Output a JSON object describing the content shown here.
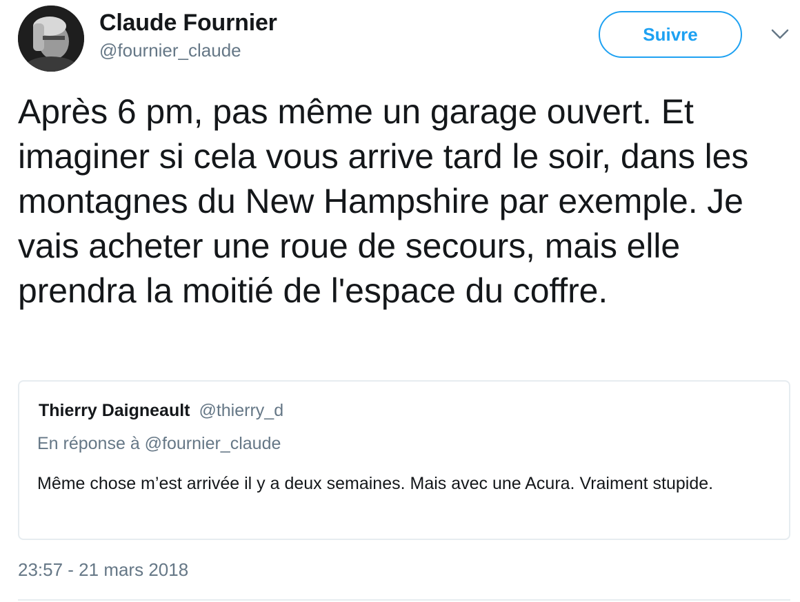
{
  "author": {
    "display_name": "Claude Fournier",
    "handle": "@fournier_claude"
  },
  "follow_button": {
    "label": "Suivre",
    "color": "#1da1f2"
  },
  "menu": {
    "icon": "chevron-down-icon"
  },
  "tweet": {
    "text": "Après 6 pm, pas même un garage ouvert. Et imaginer si cela vous arrive tard le soir, dans les montagnes du New Hampshire par exemple. Je vais acheter une roue de secours, mais elle prendra la moitié de l'espace du coffre.",
    "timestamp": "23:57 - 21 mars 2018"
  },
  "quoted_tweet": {
    "display_name": "Thierry Daigneault",
    "handle": "@thierry_d",
    "reply_context": "En réponse à @fournier_claude",
    "text": "Même chose m’est arrivée il y a deux semaines. Mais avec une Acura. Vraiment stupide."
  },
  "colors": {
    "text_primary": "#14171a",
    "text_secondary": "#657786",
    "border": "#e6ecf0"
  }
}
